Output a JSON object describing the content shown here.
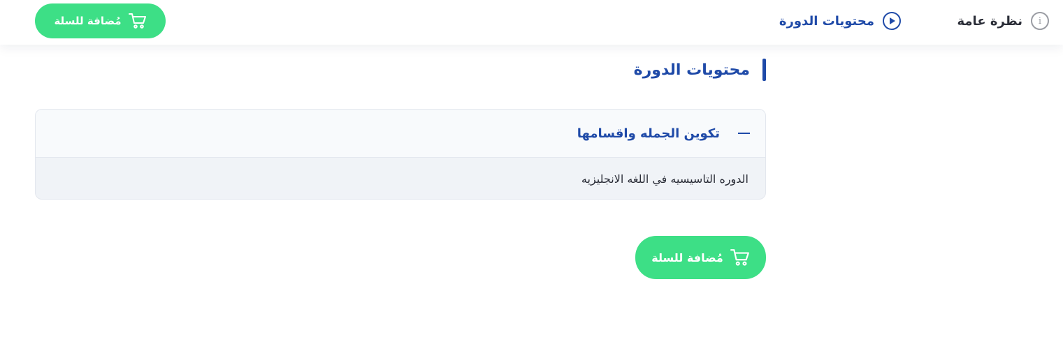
{
  "nav": {
    "overview_label": "نظرة عامة",
    "content_label": "محتويات الدورة"
  },
  "cart": {
    "label": "مُضافة للسلة"
  },
  "section": {
    "title": "محتويات الدورة"
  },
  "accordion": {
    "title": "تكوين الجمله واقسامها",
    "lessons": [
      "الدوره التاسيسيه في اللغه الانجليزيه"
    ]
  },
  "colors": {
    "primary": "#1f4aa8",
    "accent_green": "#3ddf86",
    "text_dark": "#2b2e38"
  },
  "icons": {
    "overview": "info-icon",
    "content": "play-circle-icon",
    "cart": "cart-icon",
    "collapse": "minus-icon"
  }
}
